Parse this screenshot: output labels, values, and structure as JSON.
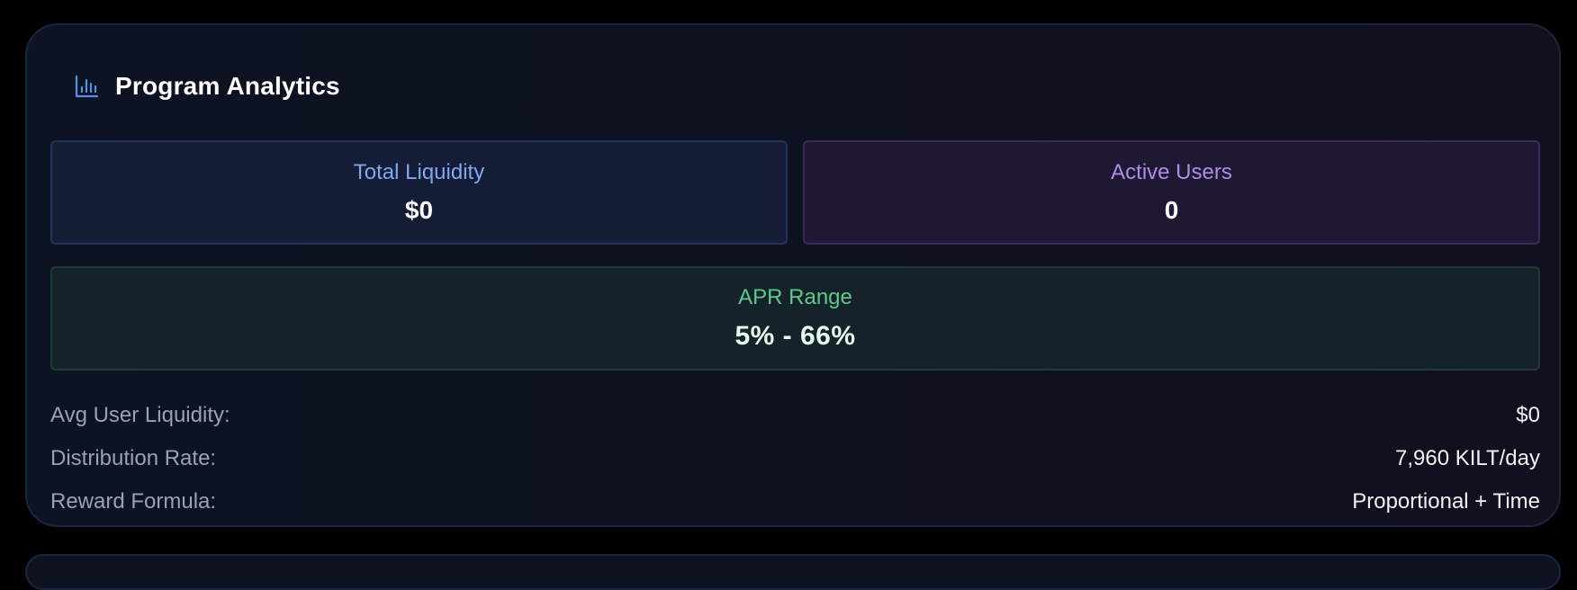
{
  "header": {
    "title": "Program Analytics",
    "icon": "bar-chart-icon"
  },
  "stats": {
    "total_liquidity": {
      "label": "Total Liquidity",
      "value": "$0"
    },
    "active_users": {
      "label": "Active Users",
      "value": "0"
    },
    "apr_range": {
      "label": "APR Range",
      "value": "5% - 66%"
    }
  },
  "details": [
    {
      "label": "Avg User Liquidity:",
      "value": "$0"
    },
    {
      "label": "Distribution Rate:",
      "value": "7,960 KILT/day"
    },
    {
      "label": "Reward Formula:",
      "value": "Proportional + Time"
    }
  ],
  "colors": {
    "liquidity_accent": "#7ea8ef",
    "users_accent": "#b18be6",
    "apr_accent": "#5ec98e"
  }
}
